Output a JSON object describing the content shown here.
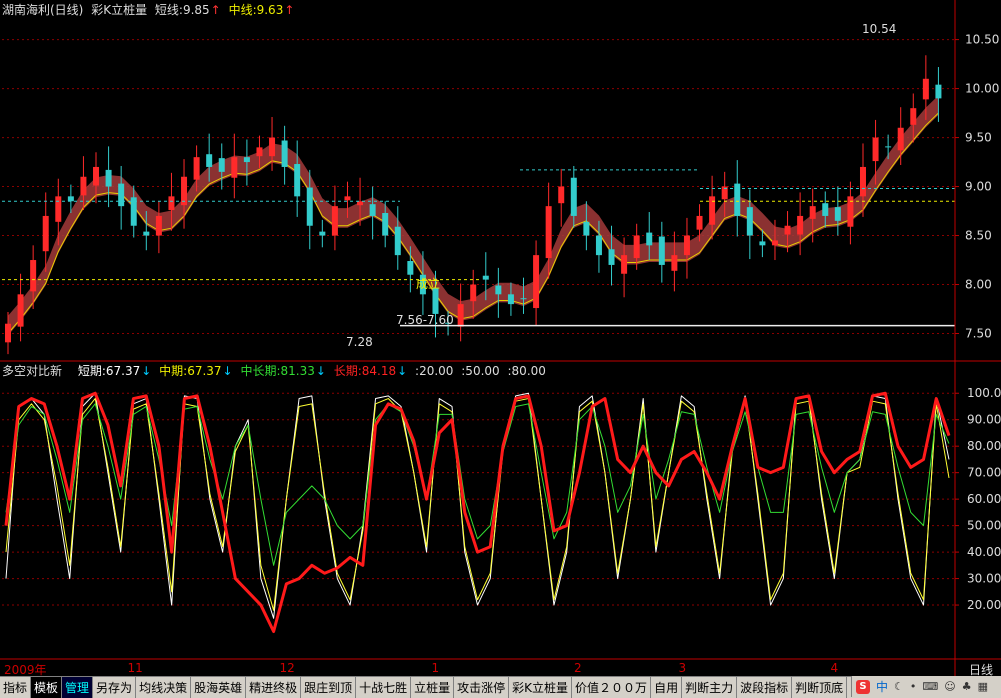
{
  "header": {
    "stock_name": "湖南海利(日线)",
    "indicator": "彩K立桩量",
    "short_label": "短线:",
    "short_value": "9.85",
    "mid_label": "中线:",
    "mid_value": "9.63",
    "arrow": "↑"
  },
  "indicator_header": {
    "name": "多空对比新",
    "short_label": "短期:",
    "short_value": "67.37",
    "mid_label": "中期:",
    "mid_value": "67.37",
    "midlong_label": "中长期:",
    "midlong_value": "81.33",
    "long_label": "长期:",
    "long_value": "84.18",
    "down_arrow": "↓",
    "levels": [
      ":20.00",
      ":50.00",
      ":80.00"
    ]
  },
  "date_axis": {
    "labels": [
      {
        "text": "2009年",
        "pos": 0.0
      },
      {
        "text": "11",
        "pos": 0.13
      },
      {
        "text": "12",
        "pos": 0.29
      },
      {
        "text": "1",
        "pos": 0.45
      },
      {
        "text": "2",
        "pos": 0.6
      },
      {
        "text": "3",
        "pos": 0.71
      },
      {
        "text": "4",
        "pos": 0.87
      }
    ],
    "period": "日线"
  },
  "tabs": [
    {
      "label": "指标",
      "state": ""
    },
    {
      "label": "模板",
      "state": "active"
    },
    {
      "label": "管理",
      "state": "sel"
    },
    {
      "label": "另存为",
      "state": ""
    },
    {
      "label": "均线决策",
      "state": ""
    },
    {
      "label": "股海英雄",
      "state": ""
    },
    {
      "label": "精进终极",
      "state": ""
    },
    {
      "label": "跟庄到顶",
      "state": ""
    },
    {
      "label": "十战七胜",
      "state": ""
    },
    {
      "label": "立桩量",
      "state": ""
    },
    {
      "label": "攻击涨停",
      "state": ""
    },
    {
      "label": "彩K立桩量",
      "state": ""
    },
    {
      "label": "价值２００万",
      "state": ""
    },
    {
      "label": "自用",
      "state": ""
    },
    {
      "label": "判断主力",
      "state": ""
    },
    {
      "label": "波段指标",
      "state": ""
    },
    {
      "label": "判断顶底",
      "state": ""
    }
  ],
  "tray": {
    "zh": "中"
  },
  "colors": {
    "up": "#ff2a2a",
    "down": "#33cccc",
    "band": "#a33a3a",
    "ma": "#e8d000",
    "grid": "#8b0000",
    "axis": "#c00000",
    "short": "#ffffff",
    "mid": "#ffff33",
    "midlong": "#33dd33",
    "long": "#ff1a1a"
  },
  "chart_data": [
    {
      "type": "candlestick",
      "price_axis": {
        "ylim": [
          7.25,
          10.7
        ],
        "ticks": [
          "10.50",
          "10.00",
          "9.50",
          "9.00",
          "8.50",
          "8.00",
          "7.50"
        ]
      },
      "annotations": [
        {
          "text": "10.54",
          "kind": "high"
        },
        {
          "text": "7.28",
          "kind": "low"
        },
        {
          "text": "7.56-7.60",
          "kind": "range"
        },
        {
          "text": "成立",
          "kind": "label"
        }
      ],
      "series": [
        {
          "name": "candles",
          "close_path": [
            7.6,
            7.9,
            8.25,
            8.7,
            8.9,
            8.85,
            9.1,
            9.2,
            9.0,
            8.8,
            8.6,
            8.5,
            8.7,
            8.9,
            9.1,
            9.3,
            9.2,
            9.15,
            9.3,
            9.25,
            9.4,
            9.5,
            9.2,
            8.9,
            8.6,
            8.5,
            8.8,
            8.9,
            8.85,
            8.7,
            8.5,
            8.3,
            8.1,
            7.9,
            7.7,
            7.6,
            7.8,
            8.0,
            8.05,
            7.9,
            7.8,
            7.85,
            8.3,
            8.8,
            9.0,
            8.7,
            8.5,
            8.3,
            8.2,
            8.3,
            8.5,
            8.4,
            8.2,
            8.3,
            8.5,
            8.7,
            8.9,
            9.0,
            8.7,
            8.5,
            8.4,
            8.45,
            8.6,
            8.7,
            8.8,
            8.7,
            8.65,
            8.9,
            9.2,
            9.5,
            9.4,
            9.6,
            9.8,
            10.1,
            9.9
          ]
        }
      ]
    },
    {
      "type": "line",
      "y_axis": {
        "ylim": [
          0,
          105
        ],
        "ticks": [
          "100.0",
          "90.00",
          "80.00",
          "70.00",
          "60.00",
          "50.00",
          "40.00",
          "30.00",
          "20.00"
        ]
      },
      "series": [
        {
          "name": "短期",
          "values": [
            30,
            95,
            98,
            92,
            60,
            30,
            95,
            100,
            70,
            40,
            96,
            98,
            60,
            20,
            99,
            98,
            60,
            40,
            80,
            90,
            30,
            15,
            60,
            98,
            99,
            60,
            30,
            20,
            50,
            98,
            99,
            95,
            70,
            40,
            98,
            95,
            40,
            20,
            30,
            80,
            99,
            100,
            60,
            20,
            40,
            95,
            99,
            70,
            30,
            60,
            98,
            40,
            70,
            99,
            95,
            60,
            30,
            80,
            99,
            60,
            20,
            30,
            98,
            99,
            60,
            30,
            70,
            75,
            99,
            98,
            60,
            30,
            20,
            98,
            75
          ]
        },
        {
          "name": "中期",
          "values": [
            40,
            90,
            96,
            90,
            65,
            35,
            92,
            98,
            72,
            42,
            94,
            96,
            62,
            25,
            96,
            95,
            62,
            42,
            78,
            88,
            35,
            18,
            60,
            95,
            96,
            62,
            32,
            22,
            48,
            96,
            98,
            93,
            70,
            42,
            96,
            93,
            42,
            22,
            32,
            78,
            97,
            98,
            60,
            22,
            42,
            93,
            97,
            70,
            32,
            60,
            96,
            42,
            70,
            97,
            93,
            62,
            32,
            78,
            97,
            62,
            22,
            32,
            96,
            97,
            62,
            32,
            70,
            72,
            97,
            96,
            62,
            32,
            22,
            96,
            68
          ]
        },
        {
          "name": "中长期",
          "values": [
            55,
            88,
            95,
            92,
            75,
            55,
            90,
            96,
            80,
            60,
            92,
            95,
            75,
            50,
            94,
            95,
            75,
            60,
            80,
            88,
            60,
            35,
            55,
            60,
            65,
            60,
            50,
            45,
            50,
            90,
            96,
            93,
            80,
            60,
            92,
            92,
            60,
            45,
            50,
            78,
            95,
            96,
            70,
            45,
            55,
            90,
            95,
            80,
            55,
            65,
            92,
            60,
            75,
            93,
            92,
            72,
            55,
            78,
            93,
            72,
            55,
            55,
            92,
            93,
            72,
            55,
            70,
            75,
            93,
            92,
            72,
            55,
            50,
            92,
            81
          ]
        },
        {
          "name": "长期",
          "values": [
            50,
            95,
            98,
            96,
            80,
            60,
            98,
            100,
            88,
            65,
            98,
            99,
            80,
            40,
            98,
            99,
            80,
            55,
            30,
            25,
            20,
            10,
            28,
            30,
            35,
            32,
            34,
            38,
            35,
            88,
            96,
            94,
            82,
            60,
            85,
            90,
            55,
            40,
            42,
            80,
            98,
            99,
            80,
            48,
            50,
            70,
            95,
            98,
            75,
            70,
            80,
            70,
            65,
            75,
            78,
            70,
            60,
            80,
            98,
            72,
            70,
            72,
            98,
            99,
            78,
            70,
            75,
            78,
            99,
            100,
            80,
            72,
            75,
            98,
            84
          ]
        }
      ]
    }
  ]
}
